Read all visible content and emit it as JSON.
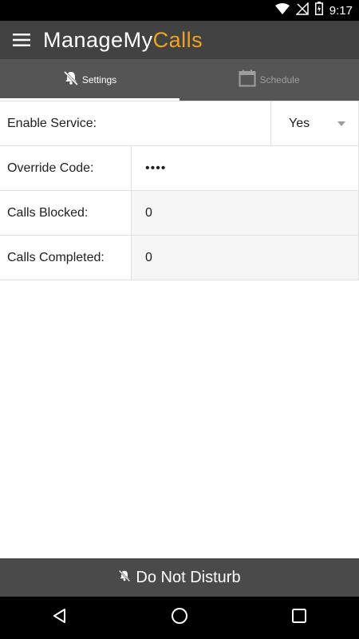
{
  "status_bar": {
    "time": "9:17"
  },
  "app_bar": {
    "title_main": "ManageMy",
    "title_accent": "Calls"
  },
  "tabs": [
    {
      "label": "Settings",
      "icon": "bell-off-icon",
      "active": true
    },
    {
      "label": "Schedule",
      "icon": "calendar-icon",
      "active": false
    }
  ],
  "settings": {
    "enable_service": {
      "label": "Enable Service:",
      "value": "Yes"
    },
    "override_code": {
      "label": "Override Code:",
      "value": "••••"
    },
    "calls_blocked": {
      "label": "Calls Blocked:",
      "value": "0"
    },
    "calls_completed": {
      "label": "Calls Completed:",
      "value": "0"
    }
  },
  "dnd_button": {
    "label": "Do Not Disturb",
    "icon": "bell-off-icon"
  },
  "colors": {
    "accent": "#f0a31e",
    "app_bar": "#424242",
    "tabs": "#555555",
    "dnd_bar": "#4a4a4a"
  }
}
